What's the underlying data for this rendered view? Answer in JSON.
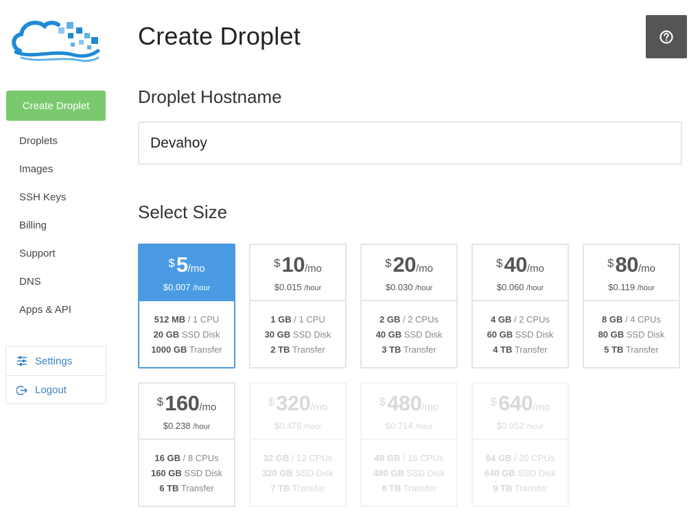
{
  "sidebar": {
    "create_label": "Create Droplet",
    "nav": [
      "Droplets",
      "Images",
      "SSH Keys",
      "Billing",
      "Support",
      "DNS",
      "Apps & API"
    ],
    "settings_label": "Settings",
    "logout_label": "Logout",
    "link_color": "#3b82c4",
    "create_color": "#7bc96f"
  },
  "header": {
    "title": "Create Droplet",
    "help_icon": "question-circle-icon"
  },
  "hostname": {
    "label": "Droplet Hostname",
    "value": "Devahoy"
  },
  "size": {
    "label": "Select Size",
    "currency": "$",
    "per_month": "/mo",
    "per_hour": "/hour",
    "selected_color": "#4a9be3",
    "plans": [
      {
        "price": "5",
        "hourly": "$0.007",
        "ram": "512 MB",
        "cpu": "/ 1 CPU",
        "disk": "20 GB",
        "disk_label": "SSD Disk",
        "transfer": "1000 GB",
        "transfer_label": "Transfer",
        "state": "selected"
      },
      {
        "price": "10",
        "hourly": "$0.015",
        "ram": "1 GB",
        "cpu": "/ 1 CPU",
        "disk": "30 GB",
        "disk_label": "SSD Disk",
        "transfer": "2 TB",
        "transfer_label": "Transfer",
        "state": "available"
      },
      {
        "price": "20",
        "hourly": "$0.030",
        "ram": "2 GB",
        "cpu": "/ 2 CPUs",
        "disk": "40 GB",
        "disk_label": "SSD Disk",
        "transfer": "3 TB",
        "transfer_label": "Transfer",
        "state": "available"
      },
      {
        "price": "40",
        "hourly": "$0.060",
        "ram": "4 GB",
        "cpu": "/ 2 CPUs",
        "disk": "60 GB",
        "disk_label": "SSD Disk",
        "transfer": "4 TB",
        "transfer_label": "Transfer",
        "state": "available"
      },
      {
        "price": "80",
        "hourly": "$0.119",
        "ram": "8 GB",
        "cpu": "/ 4 CPUs",
        "disk": "80 GB",
        "disk_label": "SSD Disk",
        "transfer": "5 TB",
        "transfer_label": "Transfer",
        "state": "available"
      },
      {
        "price": "160",
        "hourly": "$0.238",
        "ram": "16 GB",
        "cpu": "/ 8 CPUs",
        "disk": "160 GB",
        "disk_label": "SSD Disk",
        "transfer": "6 TB",
        "transfer_label": "Transfer",
        "state": "available"
      },
      {
        "price": "320",
        "hourly": "$0.476",
        "ram": "32 GB",
        "cpu": "/ 12 CPUs",
        "disk": "320 GB",
        "disk_label": "SSD Disk",
        "transfer": "7 TB",
        "transfer_label": "Transfer",
        "state": "disabled"
      },
      {
        "price": "480",
        "hourly": "$0.714",
        "ram": "48 GB",
        "cpu": "/ 16 CPUs",
        "disk": "480 GB",
        "disk_label": "SSD Disk",
        "transfer": "8 TB",
        "transfer_label": "Transfer",
        "state": "disabled"
      },
      {
        "price": "640",
        "hourly": "$0.952",
        "ram": "64 GB",
        "cpu": "/ 20 CPUs",
        "disk": "640 GB",
        "disk_label": "SSD Disk",
        "transfer": "9 TB",
        "transfer_label": "Transfer",
        "state": "disabled"
      }
    ]
  }
}
